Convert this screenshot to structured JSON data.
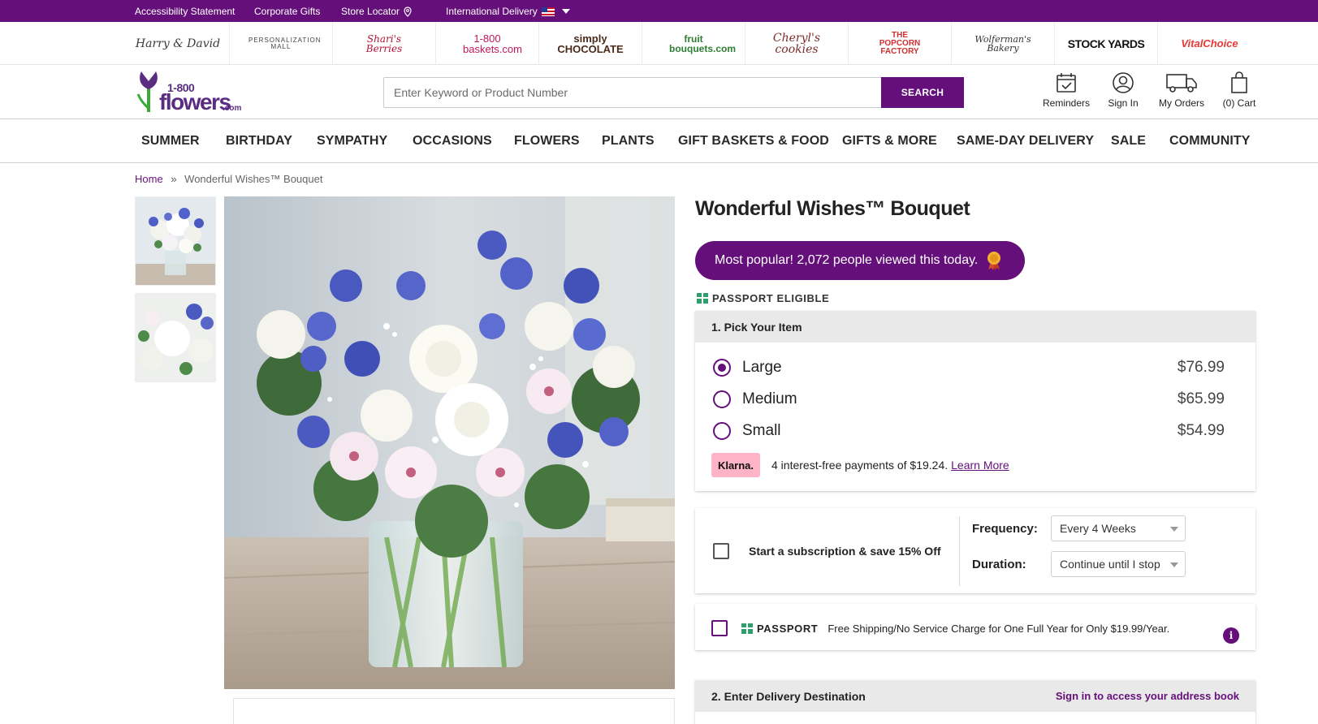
{
  "utility_bar": {
    "links": [
      {
        "id": "accessibility",
        "label": "Accessibility Statement"
      },
      {
        "id": "corporate",
        "label": "Corporate Gifts"
      },
      {
        "id": "store-locator",
        "label": "Store Locator"
      },
      {
        "id": "international",
        "label": "International Delivery"
      }
    ]
  },
  "brands": [
    {
      "name": "Harry & David",
      "color": "#3b3b3b"
    },
    {
      "name": "PERSONALIZATION MALL",
      "color": "#444444"
    },
    {
      "name": "Shari's Berries",
      "color": "#b5123a"
    },
    {
      "name": "1-800 baskets.com",
      "color": "#c2185b"
    },
    {
      "name": "simply CHOCOLATE",
      "color": "#4a2a1a"
    },
    {
      "name": "fruit bouquets.com",
      "color": "#2e7d32"
    },
    {
      "name": "Cheryl's cookies",
      "color": "#7a2a2a"
    },
    {
      "name": "THE POPCORN FACTORY",
      "color": "#d32f2f"
    },
    {
      "name": "Wolferman's Bakery",
      "color": "#333333"
    },
    {
      "name": "STOCK YARDS",
      "color": "#111111"
    },
    {
      "name": "VitalChoice",
      "color": "#e53935"
    }
  ],
  "header": {
    "logo": {
      "top": "1-800",
      "main": "flowers",
      "suffix": ".com"
    },
    "search": {
      "placeholder": "Enter Keyword or Product Number",
      "button": "SEARCH"
    },
    "actions": [
      {
        "id": "reminders",
        "label": "Reminders",
        "icon": "calendar-icon"
      },
      {
        "id": "sign-in",
        "label": "Sign In",
        "icon": "user-icon"
      },
      {
        "id": "orders",
        "label": "My Orders",
        "icon": "truck-icon"
      },
      {
        "id": "cart",
        "label": "(0) Cart",
        "icon": "shopping-bag-icon"
      }
    ]
  },
  "nav": [
    "SUMMER",
    "BIRTHDAY",
    "SYMPATHY",
    "OCCASIONS",
    "FLOWERS",
    "PLANTS",
    "GIFT BASKETS & FOOD",
    "GIFTS & MORE",
    "SAME-DAY DELIVERY",
    "SALE",
    "COMMUNITY"
  ],
  "breadcrumb": {
    "home": "Home",
    "separator": "»",
    "current": "Wonderful Wishes™ Bouquet"
  },
  "product": {
    "title": "Wonderful Wishes™ Bouquet",
    "popular": "Most popular! 2,072 people viewed this today.",
    "passport_eligible": "PASSPORT ELIGIBLE",
    "pick": {
      "heading": "1. Pick Your Item",
      "options": [
        {
          "label": "Large",
          "price": "$76.99",
          "selected": true
        },
        {
          "label": "Medium",
          "price": "$65.99",
          "selected": false
        },
        {
          "label": "Small",
          "price": "$54.99",
          "selected": false
        }
      ],
      "klarna": {
        "badge": "Klarna.",
        "text": "4 interest-free payments of $19.24.",
        "link": "Learn More"
      }
    },
    "subscription": {
      "text": "Start a subscription & save 15% Off",
      "frequency_label": "Frequency:",
      "frequency_value": "Every 4 Weeks",
      "duration_label": "Duration:",
      "duration_value": "Continue until I stop"
    },
    "passport": {
      "logo": "PASSPORT",
      "text": "Free Shipping/No Service Charge for One Full Year for Only $19.99/Year.",
      "info": "i"
    },
    "delivery": {
      "heading": "2. Enter Delivery Destination",
      "link": "Sign in to access your address book"
    }
  },
  "colors": {
    "brand_purple": "#65107a",
    "klarna_pink": "#ffb3c7",
    "passport_green": "#2e9e6b"
  }
}
